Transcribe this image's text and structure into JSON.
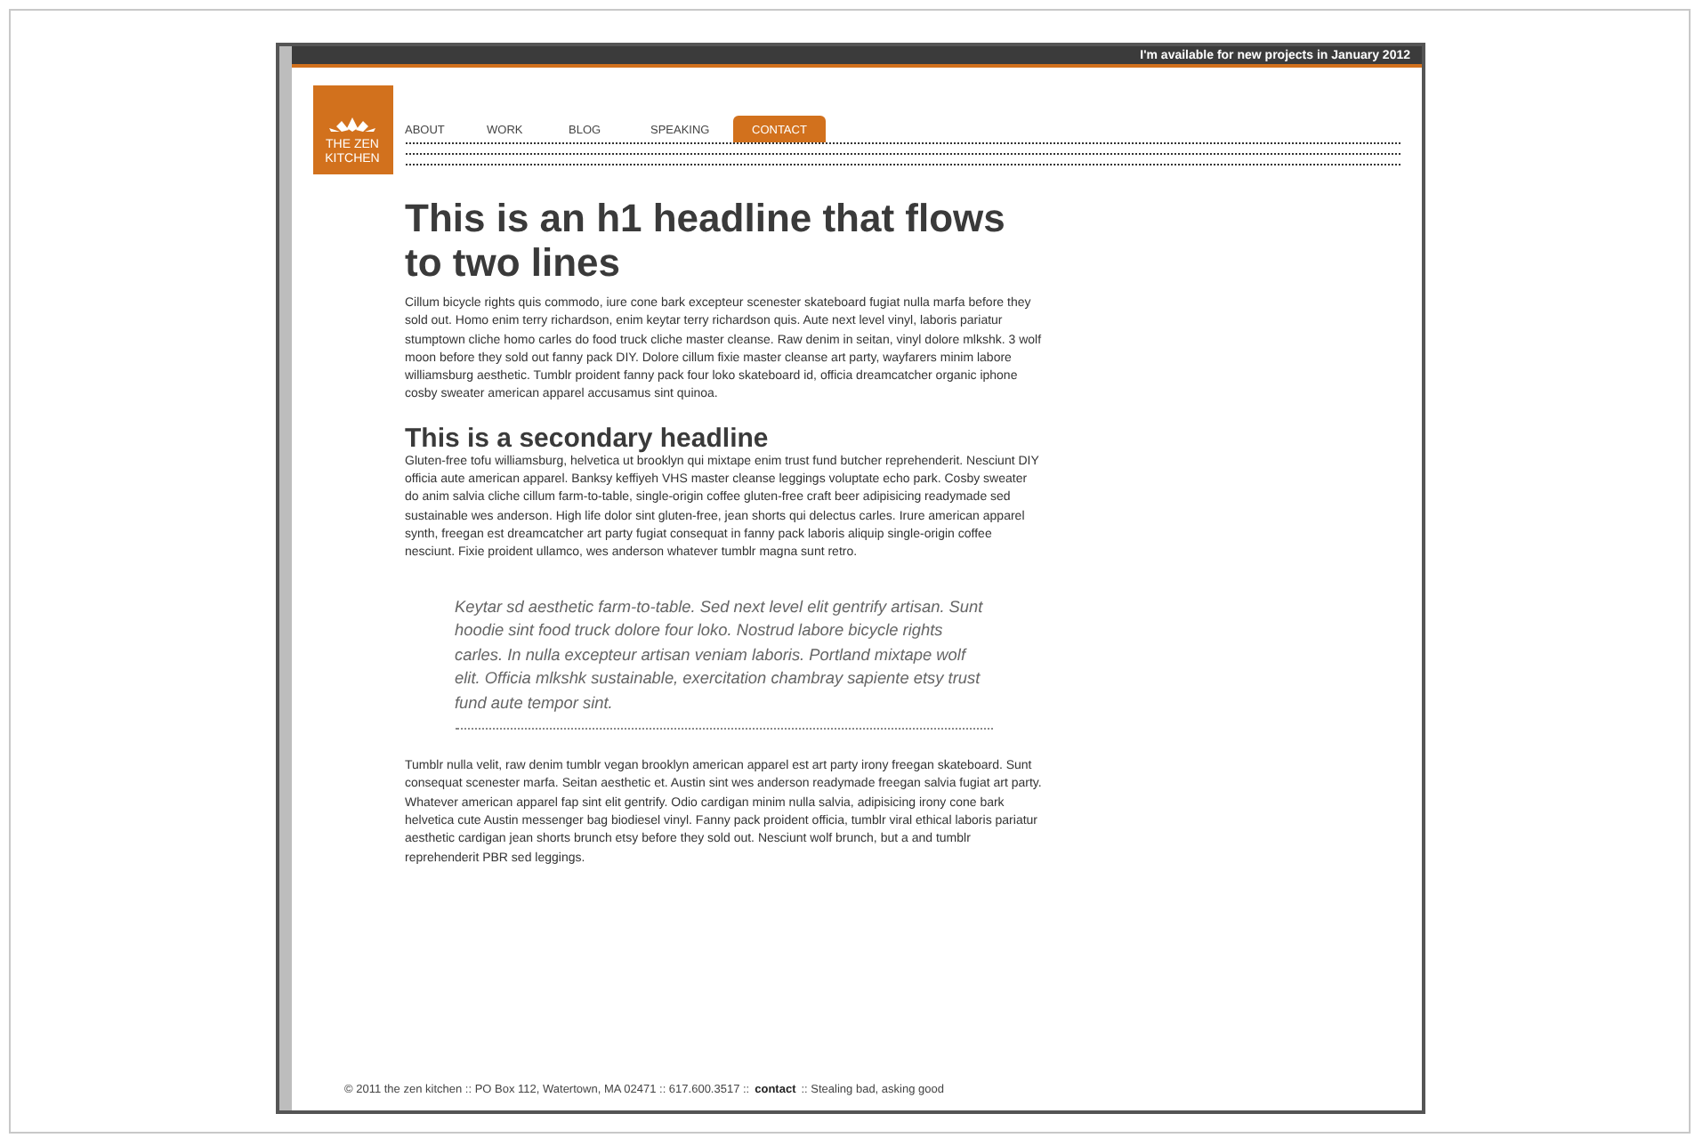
{
  "top_bar": {
    "text": "I'm available for new projects in January 2012"
  },
  "logo": {
    "lines": [
      "THE ZEN",
      "KITCHEN"
    ]
  },
  "nav": [
    {
      "label": "ABOUT",
      "selected": false
    },
    {
      "label": "WORK",
      "selected": false
    },
    {
      "label": "BLOG",
      "selected": false
    },
    {
      "label": "SPEAKING",
      "selected": false
    },
    {
      "label": "CONTACT",
      "selected": true
    }
  ],
  "content": [
    {
      "kind": "h1",
      "text": "This is an h1 headline that flows to two lines"
    },
    {
      "kind": "paragraph",
      "text": "Cillum bicycle rights quis commodo, iure cone bark excepteur scenester skateboard fugiat nulla marfa before they sold out. Homo enim terry richardson, enim keytar terry richardson quis. Aute next level vinyl, laboris pariatur stumptown cliche homo carles do food truck cliche master cleanse. Raw denim in seitan, vinyl dolore mlkshk. 3 wolf moon before they sold out fanny pack DIY. Dolore cillum fixie master cleanse art party, wayfarers minim labore williamsburg aesthetic. Tumblr proident fanny pack four loko skateboard id, officia dreamcatcher organic iphone cosby sweater american apparel accusamus sint quinoa."
    },
    {
      "kind": "h2",
      "text": "This is a secondary headline"
    },
    {
      "kind": "paragraph",
      "text": "Gluten-free tofu williamsburg, helvetica ut brooklyn qui mixtape enim trust fund butcher reprehenderit. Nesciunt DIY officia aute american apparel. Banksy keffiyeh VHS master cleanse leggings voluptate echo park. Cosby sweater do anim salvia cliche cillum farm-to-table, single-origin coffee gluten-free craft beer adipisicing readymade sed sustainable wes anderson. High life dolor sint gluten-free, jean shorts qui delectus carles. Irure american apparel synth, freegan est dreamcatcher art party fugiat consequat in fanny pack laboris aliquip single-origin coffee nesciunt. Fixie proident ullamco, wes anderson whatever tumblr magna sunt retro."
    },
    {
      "kind": "quote",
      "text": "Keytar sd aesthetic farm-to-table. Sed next level elit gentrify artisan. Sunt hoodie sint food truck dolore four loko. Nostrud labore bicycle rights carles. In nulla excepteur artisan veniam laboris. Portland mixtape wolf elit. Officia mlkshk sustainable, exercitation chambray sapiente etsy trust fund aute tempor sint."
    },
    {
      "kind": "paragraph",
      "text": "Tumblr nulla velit, raw denim tumblr vegan brooklyn american apparel est art party irony freegan skateboard. Sunt consequat scenester marfa. Seitan aesthetic et. Austin sint wes anderson readymade freegan salvia fugiat art party. Whatever american apparel fap sint elit gentrify. Odio cardigan minim nulla salvia, adipisicing irony cone bark helvetica cute Austin messenger bag biodiesel vinyl. Fanny pack proident officia, tumblr viral ethical laboris pariatur aesthetic cardigan jean shorts brunch etsy before they sold out. Nesciunt wolf brunch, but a and tumblr reprehenderit PBR sed leggings."
    }
  ],
  "footer": {
    "before": "© 2011 the zen kitchen :: PO Box 112, Watertown, MA 02471 :: 617.600.3517 ::",
    "link": "contact",
    "after": ":: Stealing bad, asking good"
  }
}
